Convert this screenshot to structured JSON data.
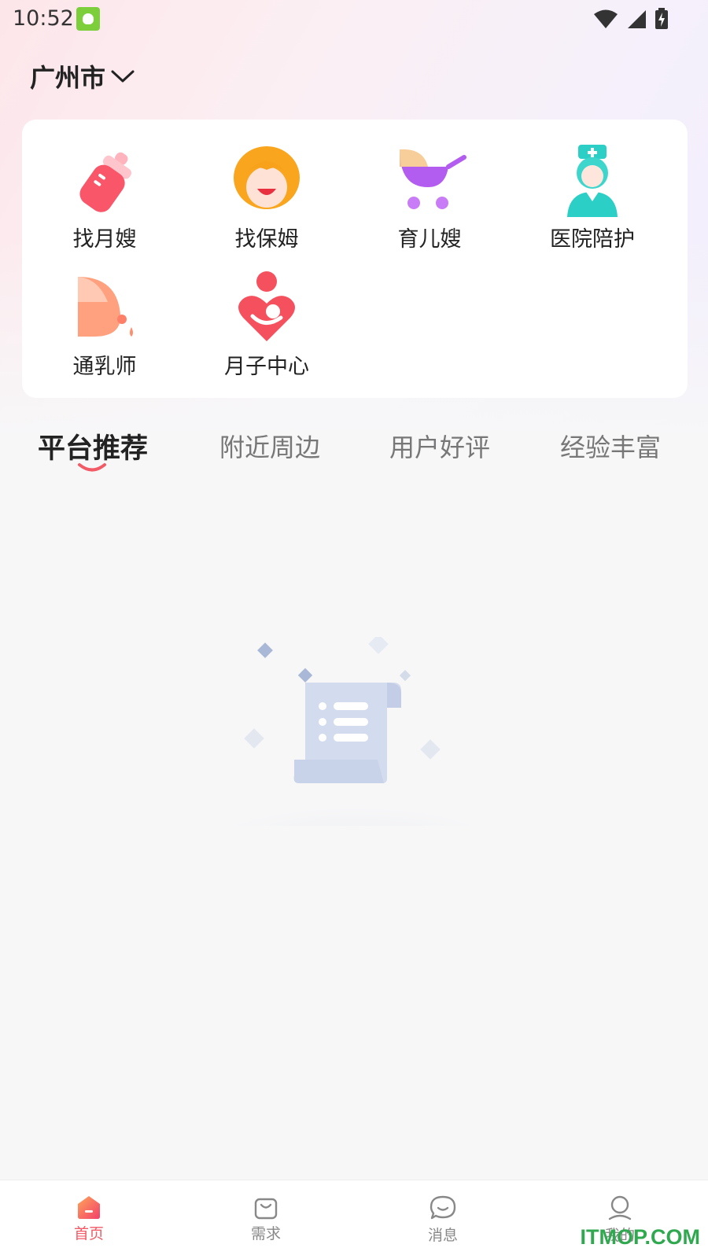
{
  "status_bar": {
    "time": "10:52",
    "icons": [
      "app-notification-icon",
      "wifi-icon",
      "signal-icon",
      "battery-charging-icon"
    ]
  },
  "location": {
    "city": "广州市",
    "icon": "chevron-down-icon"
  },
  "services": [
    {
      "label": "找月嫂",
      "icon": "baby-bottle-icon",
      "color": "#f9566a"
    },
    {
      "label": "找保姆",
      "icon": "nanny-face-icon",
      "color": "#f8a21c"
    },
    {
      "label": "育儿嫂",
      "icon": "baby-stroller-icon",
      "color": "#b25cf0"
    },
    {
      "label": "医院陪护",
      "icon": "nurse-icon",
      "color": "#2ccfc6"
    },
    {
      "label": "通乳师",
      "icon": "breast-milk-icon",
      "color": "#ff8f6a"
    },
    {
      "label": "月子中心",
      "icon": "mother-baby-heart-icon",
      "color": "#f5505e"
    }
  ],
  "tabs": [
    {
      "label": "平台推荐",
      "active": true
    },
    {
      "label": "附近周边",
      "active": false
    },
    {
      "label": "用户好评",
      "active": false
    },
    {
      "label": "经验丰富",
      "active": false
    }
  ],
  "accent_color": "#f25a66",
  "empty_state": {
    "icon": "empty-list-scroll-icon"
  },
  "bottom_nav": [
    {
      "label": "首页",
      "icon": "home-icon",
      "active": true
    },
    {
      "label": "需求",
      "icon": "shopping-bag-icon",
      "active": false
    },
    {
      "label": "消息",
      "icon": "chat-bubble-icon",
      "active": false
    },
    {
      "label": "我的",
      "icon": "profile-icon",
      "active": false
    }
  ],
  "watermark": "ITMOP.COM"
}
